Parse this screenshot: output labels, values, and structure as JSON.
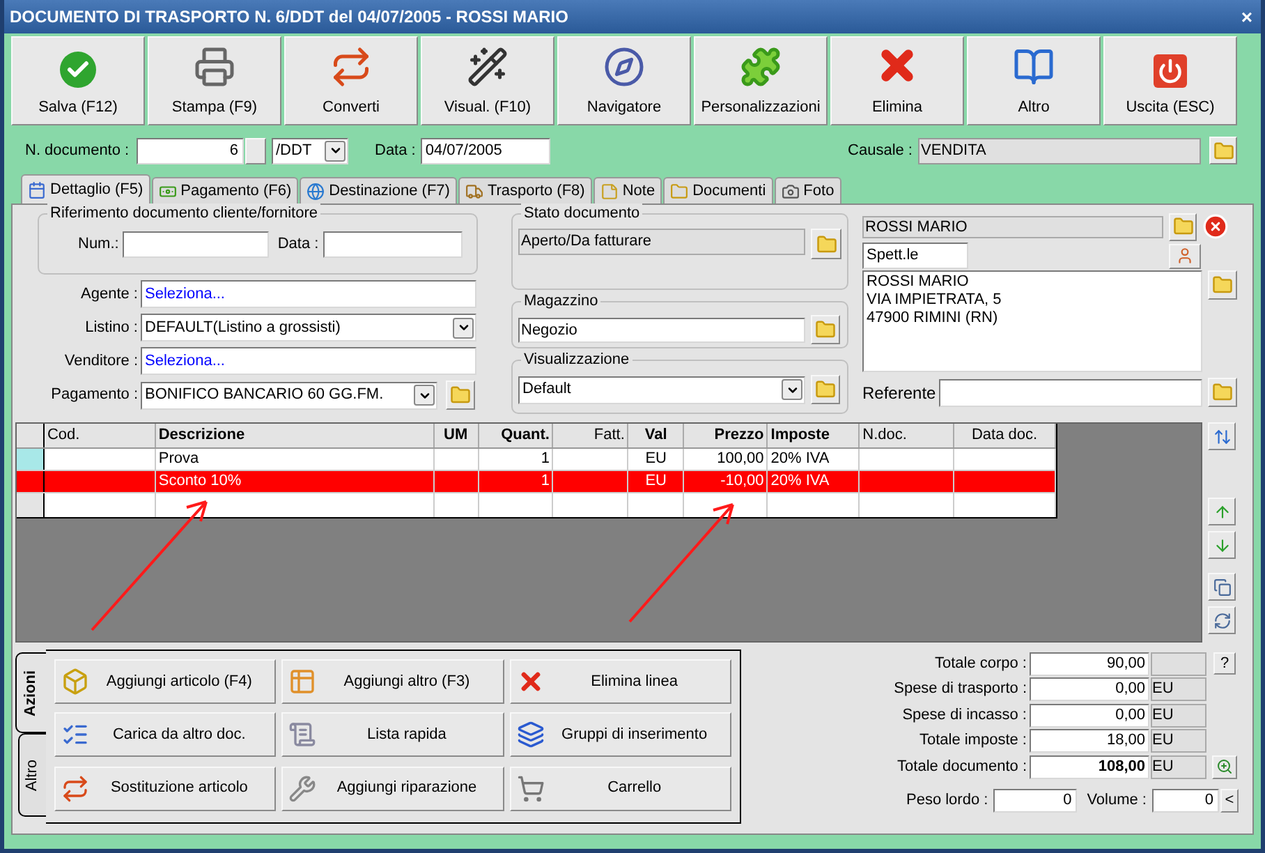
{
  "window": {
    "title": "DOCUMENTO DI TRASPORTO N. 6/DDT del 04/07/2005 - ROSSI MARIO",
    "close": "×"
  },
  "toolbar": [
    {
      "label": "Salva (F12)"
    },
    {
      "label": "Stampa (F9)"
    },
    {
      "label": "Converti"
    },
    {
      "label": "Visual. (F10)"
    },
    {
      "label": "Navigatore"
    },
    {
      "label": "Personalizzazioni"
    },
    {
      "label": "Elimina"
    },
    {
      "label": "Altro"
    },
    {
      "label": "Uscita (ESC)"
    }
  ],
  "header": {
    "number_label": "N. documento :",
    "number": "6",
    "series": "/DDT",
    "date_label": "Data :",
    "date": "04/07/2005",
    "causale_label": "Causale :",
    "causale": "VENDITA"
  },
  "tabs": [
    {
      "label": "Dettaglio (F5)",
      "selected": true
    },
    {
      "label": "Pagamento (F6)",
      "selected": false
    },
    {
      "label": "Destinazione (F7)",
      "selected": false
    },
    {
      "label": "Trasporto (F8)",
      "selected": false
    },
    {
      "label": "Note",
      "selected": false
    },
    {
      "label": "Documenti",
      "selected": false
    },
    {
      "label": "Foto",
      "selected": false
    }
  ],
  "reference": {
    "title": "Riferimento documento cliente/fornitore",
    "num_label": "Num.:",
    "date_label": "Data :"
  },
  "fields": [
    {
      "label": "Agente :",
      "value": "Seleziona...",
      "kind": "link"
    },
    {
      "label": "Listino :",
      "value": "DEFAULT(Listino a grossisti)",
      "kind": "combo"
    },
    {
      "label": "Venditore :",
      "value": "Seleziona...",
      "kind": "link"
    },
    {
      "label": "Pagamento :",
      "value": "BONIFICO BANCARIO 60 GG.FM.",
      "kind": "combo_folder"
    }
  ],
  "status": {
    "title": "Stato documento",
    "value": "Aperto/Da fatturare"
  },
  "warehouse": {
    "title": "Magazzino",
    "value": "Negozio"
  },
  "view": {
    "title": "Visualizzazione",
    "value": "Default"
  },
  "customer": {
    "name": "ROSSI MARIO",
    "salutation": "Spett.le",
    "address": [
      "ROSSI MARIO",
      "VIA IMPIETRATA, 5",
      "47900 RIMINI (RN)"
    ],
    "referente_label": "Referente"
  },
  "table": {
    "columns": [
      {
        "label": "Cod.",
        "bold": false
      },
      {
        "label": "Descrizione",
        "bold": true
      },
      {
        "label": "UM",
        "bold": true
      },
      {
        "label": "Quant.",
        "bold": true
      },
      {
        "label": "Fatt.",
        "bold": false
      },
      {
        "label": "Val",
        "bold": true
      },
      {
        "label": "Prezzo",
        "bold": true
      },
      {
        "label": "Imposte",
        "bold": true
      },
      {
        "label": "N.doc.",
        "bold": false
      },
      {
        "label": "Data doc.",
        "bold": false
      }
    ],
    "rows": [
      {
        "descrizione": "Prova",
        "quant": "1",
        "val": "EU",
        "prezzo": "100,00",
        "imposte": "20% IVA",
        "selected": true,
        "highlighted": false
      },
      {
        "descrizione": "Sconto 10%",
        "quant": "1",
        "val": "EU",
        "prezzo": "-10,00",
        "imposte": "20% IVA",
        "selected": false,
        "highlighted": true
      }
    ]
  },
  "action_tabs": [
    {
      "label": "Azioni",
      "selected": true
    },
    {
      "label": "Altro",
      "selected": false
    }
  ],
  "actions": [
    {
      "label": "Aggiungi articolo (F4)"
    },
    {
      "label": "Aggiungi altro (F3)"
    },
    {
      "label": "Elimina linea"
    },
    {
      "label": "Carica da altro doc."
    },
    {
      "label": "Lista rapida"
    },
    {
      "label": "Gruppi di inserimento"
    },
    {
      "label": "Sostituzione articolo"
    },
    {
      "label": "Aggiungi riparazione"
    },
    {
      "label": "Carrello"
    }
  ],
  "totals": [
    {
      "label": "Totale corpo :",
      "value": "90,00",
      "kind": "help",
      "button": "?",
      "emphasized": false
    },
    {
      "label": "Spese di trasporto :",
      "value": "0,00",
      "currency": "EU",
      "kind": "plain",
      "emphasized": false
    },
    {
      "label": "Spese di incasso :",
      "value": "0,00",
      "currency": "EU",
      "kind": "plain",
      "emphasized": false
    },
    {
      "label": "Totale imposte :",
      "value": "18,00",
      "currency": "EU",
      "kind": "plain",
      "emphasized": false
    },
    {
      "label": "Totale documento :",
      "value": "108,00",
      "currency": "EU",
      "kind": "zoom",
      "emphasized": true
    }
  ],
  "weight": {
    "label": "Peso lordo :",
    "value": "0",
    "volume_label": "Volume :",
    "volume": "0",
    "button": "<"
  }
}
